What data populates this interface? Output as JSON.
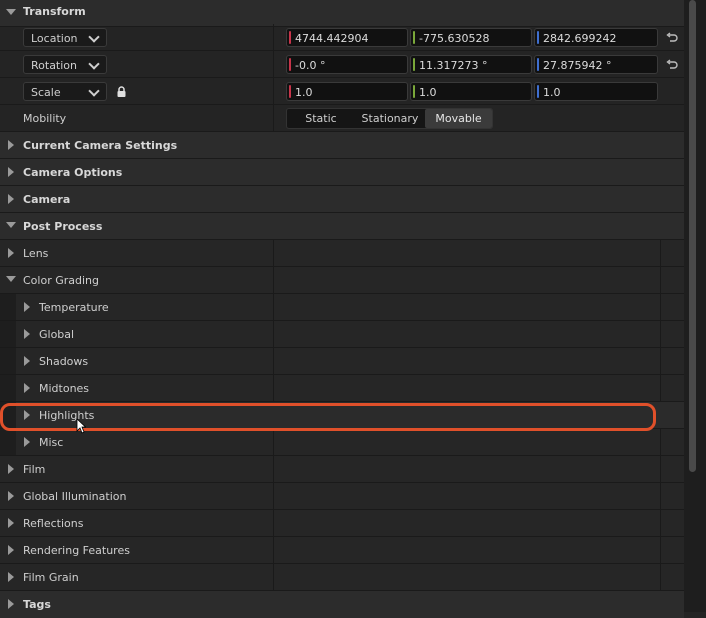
{
  "transform": {
    "header": "Transform",
    "location": {
      "label": "Location",
      "x": "4744.442904",
      "y": "-775.630528",
      "z": "2842.699242"
    },
    "rotation": {
      "label": "Rotation",
      "x": "-0.0 °",
      "y": "11.317273 °",
      "z": "27.875942 °"
    },
    "scale": {
      "label": "Scale",
      "x": "1.0",
      "y": "1.0",
      "z": "1.0"
    },
    "mobility": {
      "label": "Mobility",
      "options": [
        "Static",
        "Stationary",
        "Movable"
      ],
      "selected": "Movable"
    }
  },
  "sections": {
    "current_camera_settings": "Current Camera Settings",
    "camera_options": "Camera Options",
    "camera": "Camera",
    "post_process": "Post Process"
  },
  "post_process": {
    "lens": "Lens",
    "color_grading": "Color Grading",
    "color_grading_items": [
      "Temperature",
      "Global",
      "Shadows",
      "Midtones",
      "Highlights",
      "Misc"
    ],
    "film": "Film",
    "global_illumination": "Global Illumination",
    "reflections": "Reflections",
    "rendering_features": "Rendering Features",
    "film_grain": "Film Grain"
  },
  "tags": "Tags",
  "colors": {
    "x_axis": "#c8344a",
    "y_axis": "#7aa83a",
    "z_axis": "#3f6fd0",
    "highlight": "#e0502a"
  }
}
